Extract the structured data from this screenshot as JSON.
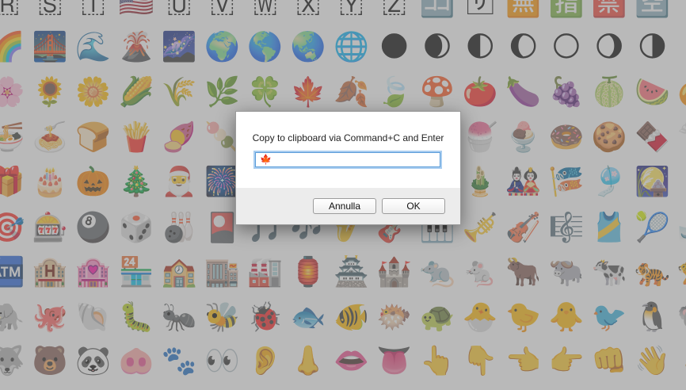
{
  "dialog": {
    "message": "Copy to clipboard via Command+C and Enter",
    "input_value": "🍁",
    "cancel_label": "Annulla",
    "ok_label": "OK"
  },
  "emoji_rows": [
    [
      "🇷",
      "🇸",
      "🇹",
      "🇺🇸",
      "🇺",
      "🇻",
      "🇼",
      "🇽",
      "🇾",
      "🇿",
      "🈁",
      "🈂",
      "🈚",
      "🈯",
      "🈲",
      "🈳"
    ],
    [
      "🌈",
      "🌉",
      "🌊",
      "🌋",
      "🌌",
      "🌍",
      "🌎",
      "🌏",
      "🌐",
      "🌑",
      "🌒",
      "🌓",
      "🌔",
      "🌕",
      "🌖",
      "🌗"
    ],
    [
      "🌸",
      "🌻",
      "🌼",
      "🌽",
      "🌾",
      "🌿",
      "🍀",
      "🍁",
      "🍂",
      "🍃",
      "🍄",
      "🍅",
      "🍆",
      "🍇",
      "🍈",
      "🍉",
      "🍊"
    ],
    [
      "🍜",
      "🍝",
      "🍞",
      "🍟",
      "🍠",
      "🍡",
      "",
      "",
      "",
      "",
      "",
      "🍧",
      "🍨",
      "🍩",
      "🍪",
      "🍫",
      "🍬"
    ],
    [
      "🎁",
      "🎂",
      "🎃",
      "🎄",
      "🎅",
      "🎆",
      "",
      "",
      "",
      "",
      "",
      "🎍",
      "🎎",
      "🎏",
      "🎐",
      "🎑"
    ],
    [
      "🎯",
      "🎰",
      "🎱",
      "🎲",
      "🎳",
      "🎴",
      "🎵",
      "🎶",
      "🎷",
      "🎸",
      "🎹",
      "🎺",
      "🎻",
      "🎼",
      "🎽",
      "🎾",
      "🎿"
    ],
    [
      "🏧",
      "🏨",
      "🏩",
      "🏪",
      "🏫",
      "🏬",
      "🏭",
      "🏮",
      "🏯",
      "🏰",
      "🐀",
      "🐁",
      "🐂",
      "🐃",
      "🐄",
      "🐅",
      "🐆"
    ],
    [
      "🐘",
      "🐙",
      "🐚",
      "🐛",
      "🐜",
      "🐝",
      "🐞",
      "🐟",
      "🐠",
      "🐡",
      "🐢",
      "🐣",
      "🐤",
      "🐥",
      "🐦",
      "🐧",
      "🐨"
    ],
    [
      "🐺",
      "🐻",
      "🐼",
      "🐽",
      "🐾",
      "👀",
      "👂",
      "👃",
      "👄",
      "👅",
      "👆",
      "👇",
      "👈",
      "👉",
      "👊",
      "👋",
      "👌"
    ]
  ]
}
